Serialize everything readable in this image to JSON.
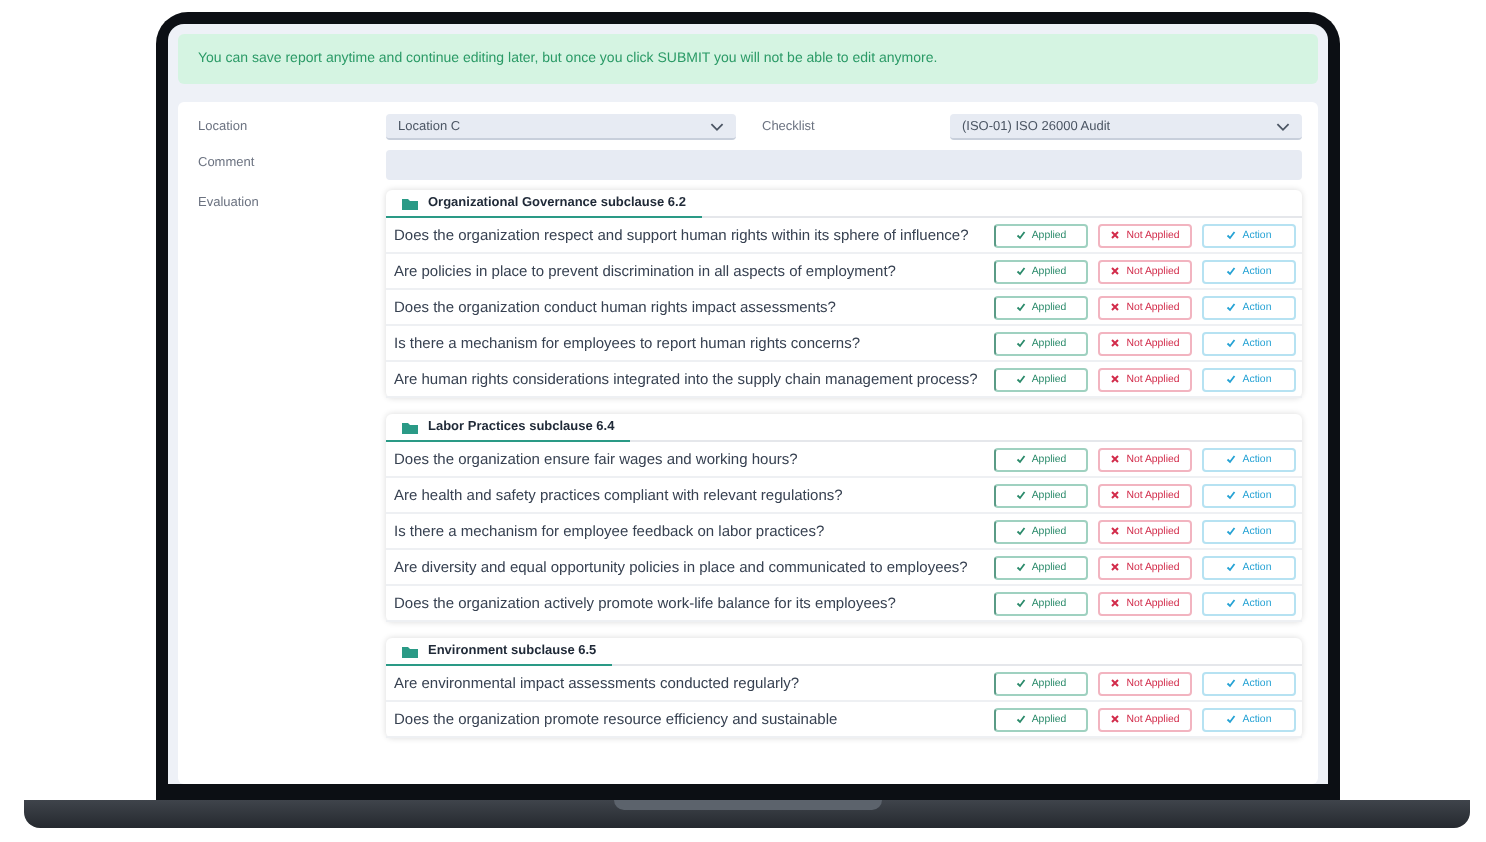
{
  "banner": {
    "text": "You can save report anytime and continue editing later, but once you click SUBMIT you will not be able to edit anymore."
  },
  "form": {
    "location": {
      "label": "Location",
      "value": "Location C"
    },
    "checklist": {
      "label": "Checklist",
      "value": "(ISO-01) ISO 26000 Audit"
    },
    "comment": {
      "label": "Comment"
    },
    "evaluation": {
      "label": "Evaluation"
    }
  },
  "sections": [
    {
      "title": "Organizational Governance subclause 6.2",
      "questions": [
        {
          "text": "Does the organization respect and support human rights within its sphere of influence?",
          "options": [
            {
              "kind": "applied",
              "label": "Applied"
            },
            {
              "kind": "not_applied",
              "label": "Not Applied"
            },
            {
              "kind": "action",
              "label": "Action"
            }
          ]
        },
        {
          "text": "Are policies in place to prevent discrimination in all aspects of employment?",
          "options": [
            {
              "kind": "applied",
              "label": "Applied"
            },
            {
              "kind": "not_applied",
              "label": "Not Applied"
            },
            {
              "kind": "action",
              "label": "Action"
            }
          ]
        },
        {
          "text": "Does the organization conduct human rights impact assessments?",
          "options": [
            {
              "kind": "applied",
              "label": "Applied"
            },
            {
              "kind": "not_applied",
              "label": "Not Applied"
            },
            {
              "kind": "action",
              "label": "Action"
            }
          ]
        },
        {
          "text": "Is there a mechanism for employees to report human rights concerns?",
          "options": [
            {
              "kind": "applied",
              "label": "Applied"
            },
            {
              "kind": "not_applied",
              "label": "Not Applied"
            },
            {
              "kind": "action",
              "label": "Action"
            }
          ]
        },
        {
          "text": "Are human rights considerations integrated into the supply chain management process?",
          "options": [
            {
              "kind": "applied",
              "label": "Applied"
            },
            {
              "kind": "not_applied",
              "label": "Not Applied"
            },
            {
              "kind": "action",
              "label": "Action"
            }
          ]
        }
      ]
    },
    {
      "title": "Labor Practices subclause 6.4",
      "questions": [
        {
          "text": "Does the organization ensure fair wages and working hours?",
          "options": [
            {
              "kind": "applied",
              "label": "Applied"
            },
            {
              "kind": "not_applied",
              "label": "Not Applied"
            },
            {
              "kind": "action",
              "label": "Action"
            }
          ]
        },
        {
          "text": "Are health and safety practices compliant with relevant regulations?",
          "options": [
            {
              "kind": "applied",
              "label": "Applied"
            },
            {
              "kind": "not_applied",
              "label": "Not Applied"
            },
            {
              "kind": "action",
              "label": "Action"
            }
          ]
        },
        {
          "text": "Is there a mechanism for employee feedback on labor practices?",
          "options": [
            {
              "kind": "applied",
              "label": "Applied"
            },
            {
              "kind": "not_applied",
              "label": "Not Applied"
            },
            {
              "kind": "action",
              "label": "Action"
            }
          ]
        },
        {
          "text": "Are diversity and equal opportunity policies in place and communicated to employees?",
          "options": [
            {
              "kind": "applied",
              "label": "Applied"
            },
            {
              "kind": "not_applied",
              "label": "Not Applied"
            },
            {
              "kind": "action",
              "label": "Action"
            }
          ]
        },
        {
          "text": "Does the organization actively promote work-life balance for its employees?",
          "options": [
            {
              "kind": "applied",
              "label": "Applied"
            },
            {
              "kind": "not_applied",
              "label": "Not Applied"
            },
            {
              "kind": "action",
              "label": "Action"
            }
          ]
        }
      ]
    },
    {
      "title": "Environment subclause 6.5",
      "questions": [
        {
          "text": "Are environmental impact assessments conducted regularly?",
          "options": [
            {
              "kind": "applied",
              "label": "Applied"
            },
            {
              "kind": "not_applied",
              "label": "Not Applied"
            },
            {
              "kind": "action",
              "label": "Action"
            }
          ]
        },
        {
          "text": "Does the organization promote resource efficiency and sustainable",
          "options": [
            {
              "kind": "applied",
              "label": "Applied"
            },
            {
              "kind": "not_applied",
              "label": "Not Applied"
            },
            {
              "kind": "action",
              "label": "Action"
            }
          ]
        }
      ]
    }
  ]
}
